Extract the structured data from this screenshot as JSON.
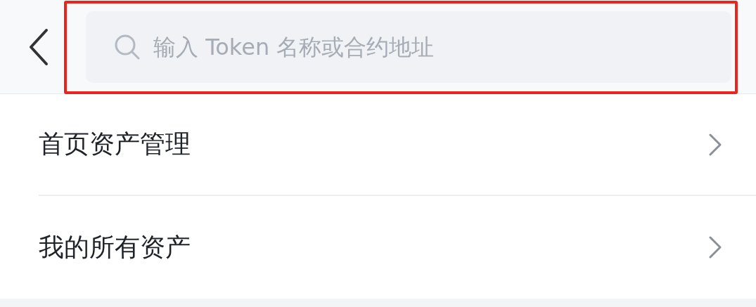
{
  "search": {
    "placeholder": "输入 Token 名称或合约地址",
    "highlighted": true
  },
  "menu": [
    {
      "label": "首页资产管理"
    },
    {
      "label": "我的所有资产"
    }
  ]
}
